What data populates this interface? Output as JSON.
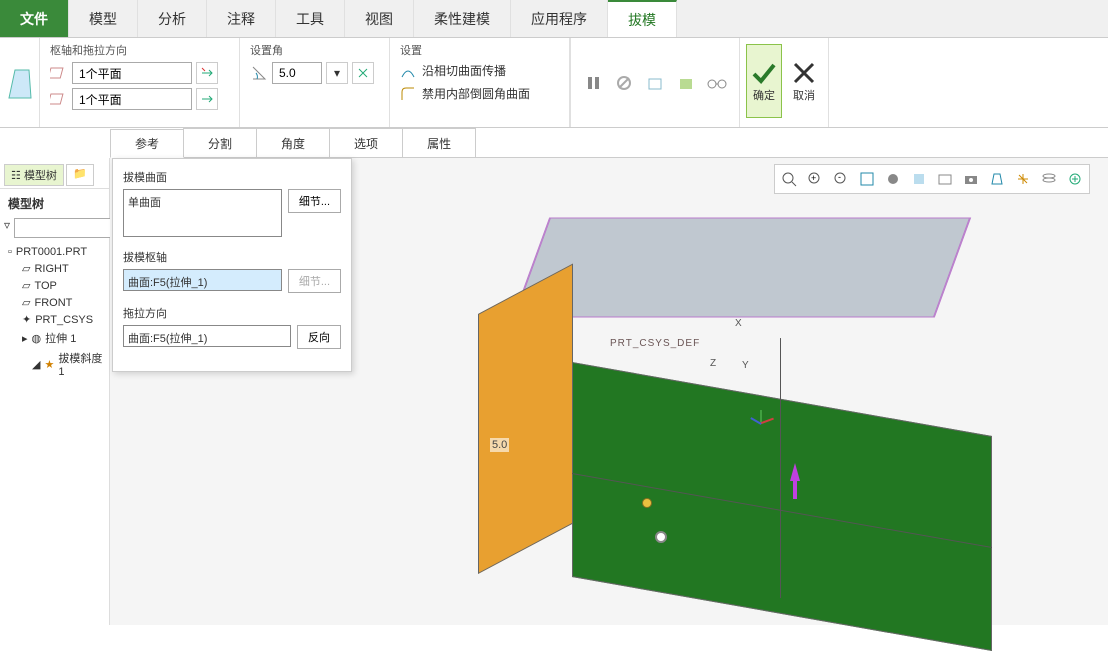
{
  "menu": {
    "file": "文件",
    "items": [
      "模型",
      "分析",
      "注释",
      "工具",
      "视图",
      "柔性建模",
      "应用程序",
      "拔模"
    ],
    "active_index": 7
  },
  "ribbon": {
    "axis_group_label": "枢轴和拖拉方向",
    "plane_input1": "1个平面",
    "plane_input2": "1个平面",
    "angle_group_label": "设置角",
    "angle_value": "5.0",
    "settings_group_label": "设置",
    "propagate_tangent": "沿相切曲面传播",
    "disable_internal_round": "禁用内部倒圆角曲面",
    "ok_label": "确定",
    "cancel_label": "取消"
  },
  "subtabs": {
    "items": [
      "参考",
      "分割",
      "角度",
      "选项",
      "属性"
    ],
    "active_index": 0
  },
  "sidebar": {
    "tab_model_tree": "模型树",
    "title": "模型树",
    "items": [
      {
        "label": "PRT0001.PRT",
        "type": "part"
      },
      {
        "label": "RIGHT",
        "type": "datum"
      },
      {
        "label": "TOP",
        "type": "datum"
      },
      {
        "label": "FRONT",
        "type": "datum"
      },
      {
        "label": "PRT_CSYS",
        "type": "csys"
      },
      {
        "label": "拉伸 1",
        "type": "feature"
      },
      {
        "label": "拔模斜度 1",
        "type": "draft"
      }
    ]
  },
  "ref_panel": {
    "surface_label": "拔模曲面",
    "surface_value": "单曲面",
    "detail_btn": "细节...",
    "hinge_label": "拔模枢轴",
    "hinge_value": "曲面:F5(拉伸_1)",
    "pull_label": "拖拉方向",
    "pull_value": "曲面:F5(拉伸_1)",
    "reverse_btn": "反向"
  },
  "viewport": {
    "csys_label": "PRT_CSYS_DEF",
    "axis_x": "X",
    "axis_y": "Y",
    "axis_z": "Z",
    "dim_value": "5.0"
  },
  "colors": {
    "green": "#3a8a3a",
    "dark_green": "#227722",
    "orange": "#e8a030",
    "gray_face": "#c0c8d0"
  }
}
